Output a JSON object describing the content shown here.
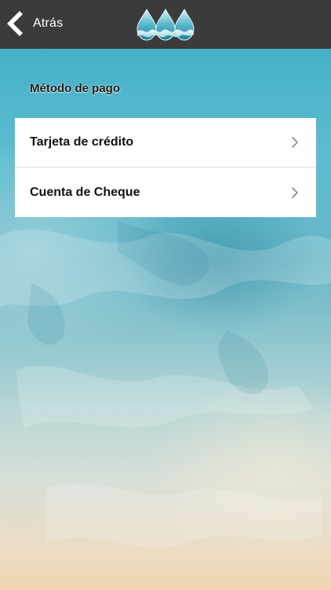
{
  "navbar": {
    "back_label": "Atrás",
    "back_icon": "chevron-left-icon",
    "logo_icon": "water-drops-logo",
    "background_color": "#3b3b3b"
  },
  "section": {
    "title": "Método de pago"
  },
  "payment_methods": [
    {
      "label": "Tarjeta de crédito",
      "icon": "chevron-right-icon"
    },
    {
      "label": "Cuenta de Cheque",
      "icon": "chevron-right-icon"
    }
  ],
  "colors": {
    "top_gradient": "#39aac3",
    "bottom_gradient": "#f0d6b3",
    "card_background": "#ffffff"
  }
}
